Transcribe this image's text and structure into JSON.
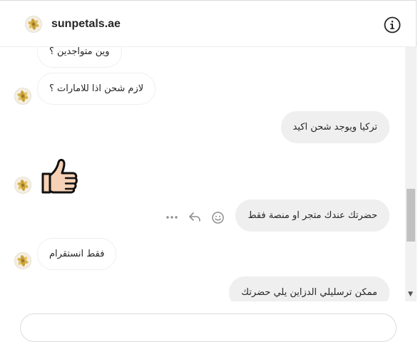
{
  "header": {
    "title": "sunpetals.ae",
    "info_icon": "info-icon"
  },
  "messages": [
    {
      "id": 1,
      "direction": "incoming",
      "text": "وين متواجدين ؟"
    },
    {
      "id": 2,
      "direction": "incoming",
      "text": "لازم شحن اذا للامارات ؟"
    },
    {
      "id": 3,
      "direction": "outgoing",
      "text": "تركيا ويوجد شحن اكيد"
    },
    {
      "id": 4,
      "direction": "incoming",
      "emoji": "thumbs-up"
    },
    {
      "id": 5,
      "direction": "outgoing",
      "text": "حضرتك عندك متجر او منصة فقط"
    },
    {
      "id": 6,
      "direction": "incoming",
      "text": "فقط انستقرام"
    },
    {
      "id": 7,
      "direction": "outgoing",
      "text": "ممكن ترسليلي الدزاين يلي حضرتك"
    }
  ],
  "message_actions": [
    "more-icon",
    "reply-icon",
    "react-icon"
  ],
  "colors": {
    "incoming_bg": "#ffffff",
    "outgoing_bg": "#efefef",
    "border": "#dbdbdb"
  }
}
